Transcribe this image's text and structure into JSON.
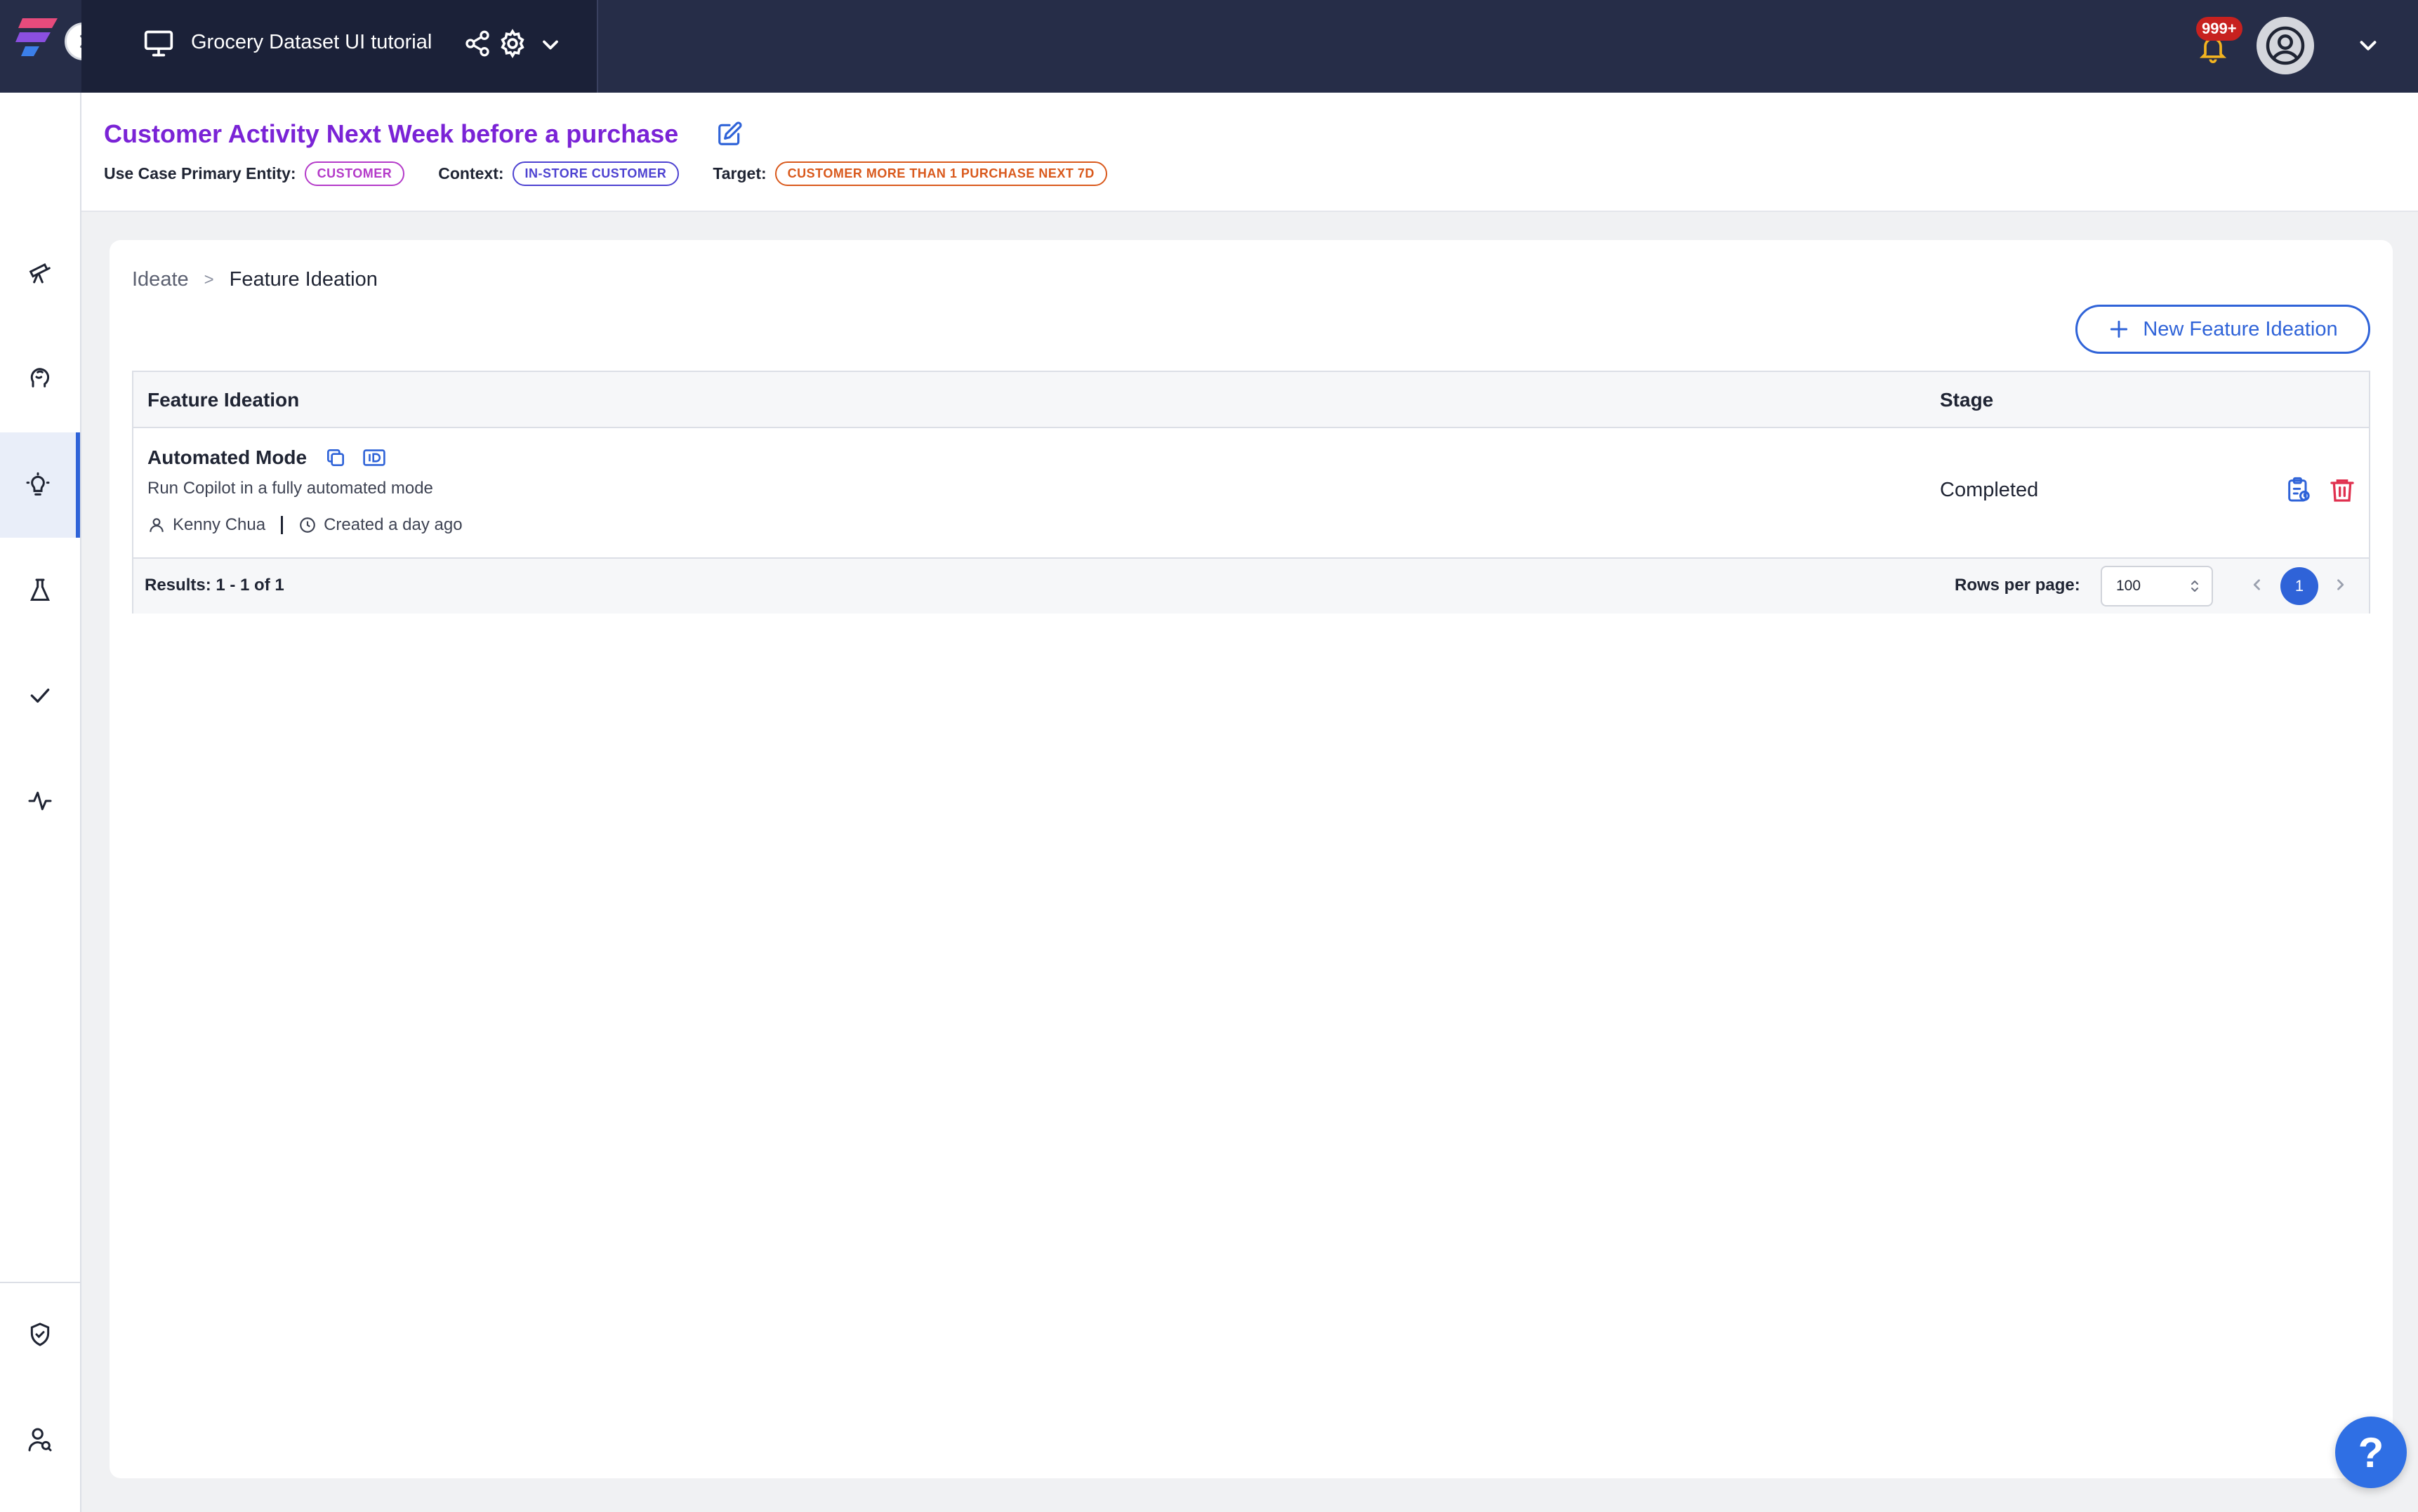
{
  "topbar": {
    "project_title": "Grocery Dataset UI tutorial",
    "notifications_badge": "999+"
  },
  "header": {
    "title": "Customer Activity Next Week before a purchase",
    "primary_entity_label": "Use Case Primary Entity:",
    "primary_entity_value": "CUSTOMER",
    "context_label": "Context:",
    "context_value": "IN-STORE CUSTOMER",
    "target_label": "Target:",
    "target_value": "CUSTOMER MORE THAN 1 PURCHASE NEXT 7D"
  },
  "breadcrumb": {
    "parent": "Ideate",
    "separator": ">",
    "current": "Feature Ideation"
  },
  "new_button_label": "New Feature Ideation",
  "table": {
    "columns": [
      "Feature Ideation",
      "Stage"
    ],
    "rows": [
      {
        "title": "Automated Mode",
        "description": "Run Copilot in a fully automated mode",
        "author": "Kenny Chua",
        "created": "Created a day ago",
        "stage": "Completed"
      }
    ]
  },
  "footer": {
    "results": "Results: 1 - 1 of 1",
    "rows_per_page_label": "Rows per page:",
    "rows_per_page_value": "100",
    "current_page": "1"
  },
  "help_label": "?",
  "colors": {
    "topbar": "#262d48",
    "accent": "#2f63d8",
    "title": "#7a23d6",
    "danger": "#e0314f"
  }
}
